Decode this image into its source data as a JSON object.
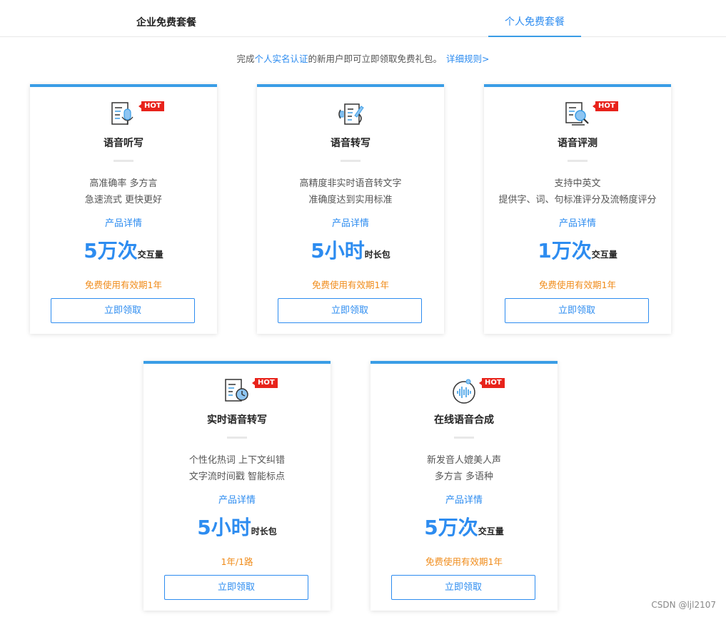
{
  "tabs": {
    "enterprise": "企业免费套餐",
    "personal": "个人免费套餐"
  },
  "notice": {
    "prefix": "完成",
    "highlight": "个人实名认证",
    "suffix": "的新用户即可立即领取免费礼包。",
    "rules_link": "详细规则>"
  },
  "colors": {
    "accent": "#3a9de6",
    "link": "#2d8cf0",
    "orange": "#f08c1b",
    "hot_badge": "#e8231b"
  },
  "cards": [
    {
      "icon": "microphone-document-icon",
      "hot": "HOT",
      "title": "语音听写",
      "desc_line1": "高准确率 多方言",
      "desc_line2": "急速流式 更快更好",
      "detail": "产品详情",
      "quota_num": "5万次",
      "quota_unit": "交互量",
      "validity": "免费使用有效期1年",
      "button": "立即领取"
    },
    {
      "icon": "audio-to-text-icon",
      "hot": "",
      "title": "语音转写",
      "desc_line1": "高精度非实时语音转文字",
      "desc_line2": "准确度达到实用标准",
      "detail": "产品详情",
      "quota_num": "5小时",
      "quota_unit": "时长包",
      "validity": "免费使用有效期1年",
      "button": "立即领取"
    },
    {
      "icon": "document-magnifier-icon",
      "hot": "HOT",
      "title": "语音评测",
      "desc_line1": "支持中英文",
      "desc_line2": "提供字、词、句标准评分及流畅度评分",
      "detail": "产品详情",
      "quota_num": "1万次",
      "quota_unit": "交互量",
      "validity": "免费使用有效期1年",
      "button": "立即领取"
    },
    {
      "icon": "document-clock-icon",
      "hot": "HOT",
      "title": "实时语音转写",
      "desc_line1": "个性化热词 上下文纠错",
      "desc_line2": "文字流时间戳 智能标点",
      "detail": "产品详情",
      "quota_num": "5小时",
      "quota_unit": "时长包",
      "validity": "1年/1路",
      "button": "立即领取"
    },
    {
      "icon": "sound-wave-circle-icon",
      "hot": "HOT",
      "title": "在线语音合成",
      "desc_line1": "新发音人媲美人声",
      "desc_line2": "多方言 多语种",
      "detail": "产品详情",
      "quota_num": "5万次",
      "quota_unit": "交互量",
      "validity": "免费使用有效期1年",
      "button": "立即领取"
    }
  ],
  "watermark": "CSDN @ljl2107"
}
